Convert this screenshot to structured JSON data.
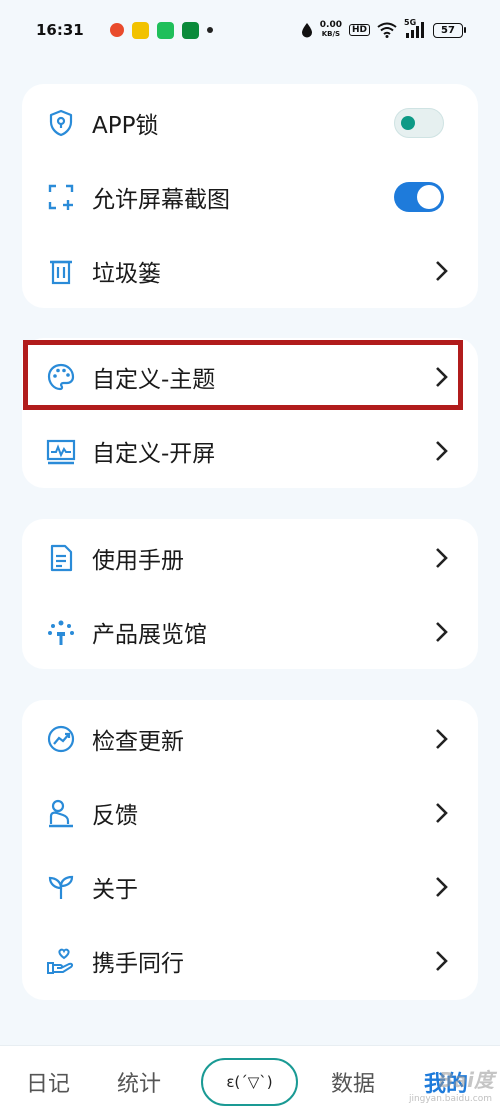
{
  "status_bar": {
    "time": "16:31",
    "net_speed_value": "0.00",
    "net_speed_unit": "KB/S",
    "hd": "HD",
    "network": "5G",
    "battery": "57"
  },
  "settings": {
    "card1": [
      {
        "label": "APP锁",
        "icon": "shield-lock-icon",
        "control": "toggle",
        "state": "off"
      },
      {
        "label": "允许屏幕截图",
        "icon": "screenshot-icon",
        "control": "toggle",
        "state": "on"
      },
      {
        "label": "垃圾篓",
        "icon": "trash-icon",
        "control": "chevron"
      }
    ],
    "card2": [
      {
        "label": "自定义-主题",
        "icon": "palette-icon",
        "control": "chevron"
      },
      {
        "label": "自定义-开屏",
        "icon": "splash-screen-icon",
        "control": "chevron"
      }
    ],
    "card3": [
      {
        "label": "使用手册",
        "icon": "manual-icon",
        "control": "chevron"
      },
      {
        "label": "产品展览馆",
        "icon": "showcase-icon",
        "control": "chevron"
      }
    ],
    "card4": [
      {
        "label": "检查更新",
        "icon": "update-icon",
        "control": "chevron"
      },
      {
        "label": "反馈",
        "icon": "feedback-icon",
        "control": "chevron"
      },
      {
        "label": "关于",
        "icon": "sprout-icon",
        "control": "chevron"
      },
      {
        "label": "携手同行",
        "icon": "heart-hand-icon",
        "control": "chevron"
      }
    ]
  },
  "bottom_nav": {
    "diary": "日记",
    "stats": "统计",
    "center": "ε(ˊ▽ˋ)",
    "data": "数据",
    "mine": "我的"
  },
  "watermark": {
    "text": "Bai度",
    "sub": "jingyan.baidu.com"
  },
  "colors": {
    "accent": "#1e7bdb",
    "icon_blue": "#2a8bd8",
    "highlight_border": "#b11c1c",
    "toggle_on": "#1e7bdb",
    "toggle_off_knob": "#0e9a86",
    "nav_center_border": "#1a9a94"
  }
}
